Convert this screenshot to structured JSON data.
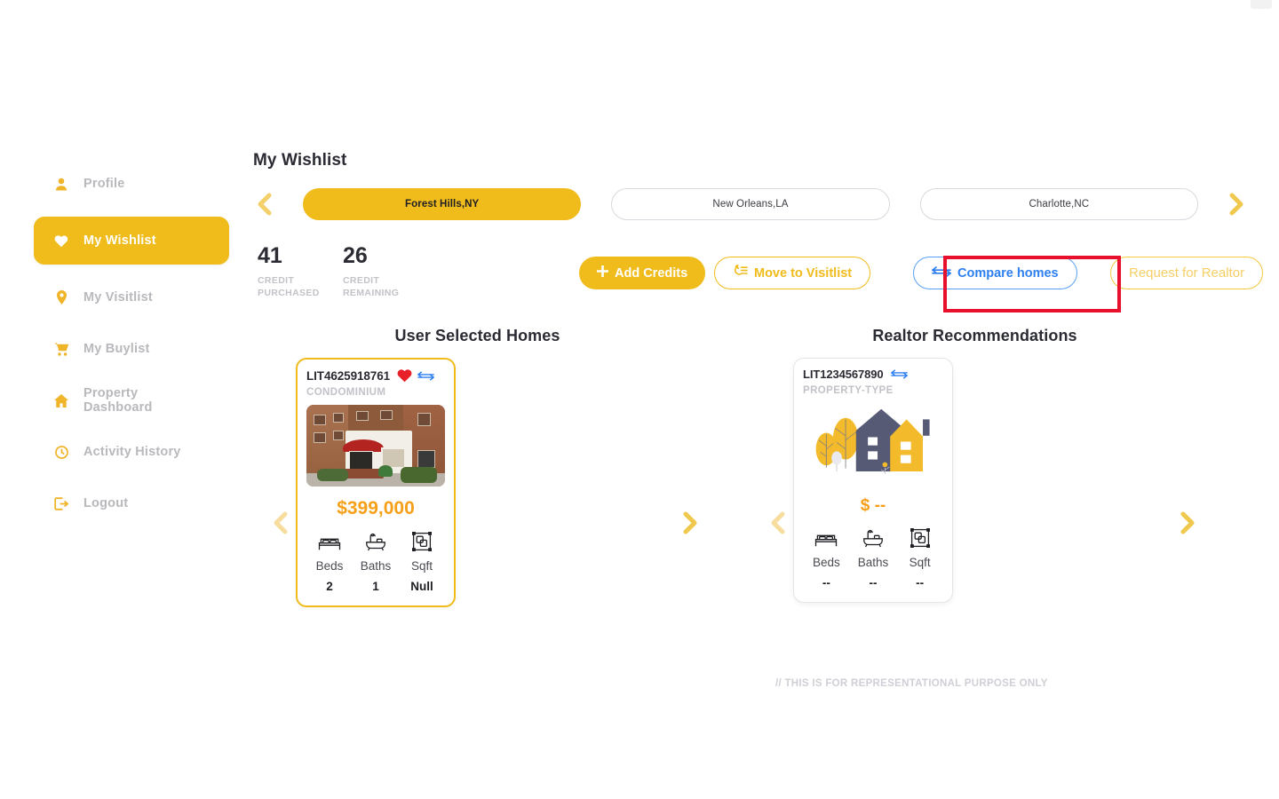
{
  "colors": {
    "brand_yellow": "#f0bc1c",
    "price_orange": "#f6a01a",
    "compare_blue": "#2d7ff0",
    "annotation_red": "#e8112d",
    "muted_gray": "#c2c2c8",
    "illustration_dark": "#575a75"
  },
  "sidebar": {
    "items": [
      {
        "label": "Profile",
        "icon": "user-icon",
        "active": false
      },
      {
        "label": "My Wishlist",
        "icon": "heart-icon",
        "active": true
      },
      {
        "label": "My Visitlist",
        "icon": "map-pin-icon",
        "active": false
      },
      {
        "label": "My Buylist",
        "icon": "cart-icon",
        "active": false
      },
      {
        "label": "Property Dashboard",
        "icon": "home-icon",
        "active": false
      },
      {
        "label": "Activity History",
        "icon": "clock-icon",
        "active": false
      },
      {
        "label": "Logout",
        "icon": "logout-icon",
        "active": false
      }
    ]
  },
  "header": {
    "title": "My Wishlist"
  },
  "city_tabs": {
    "prev_icon": "chevron-left-icon",
    "next_icon": "chevron-right-icon",
    "items": [
      {
        "label": "Forest Hills,NY",
        "active": true
      },
      {
        "label": "New Orleans,LA",
        "active": false
      },
      {
        "label": "Charlotte,NC",
        "active": false
      }
    ]
  },
  "credits": [
    {
      "value": "41",
      "label": "CREDIT PURCHASED"
    },
    {
      "value": "26",
      "label": "CREDIT REMAINING"
    }
  ],
  "toolbar": {
    "add_credits_label": "Add Credits",
    "add_credits_icon": "plus-icon",
    "move_to_visitlist_label": "Move to Visitlist",
    "move_to_visitlist_icon": "move-list-icon",
    "compare_homes_label": "Compare homes",
    "compare_homes_icon": "compare-arrows-icon",
    "request_realtor_label": "Request for Realtor"
  },
  "annotation": {
    "target": "Request for Realtor",
    "shape": "red-rectangle"
  },
  "sections": {
    "user_selected": {
      "heading": "User Selected Homes",
      "prev_icon": "chevron-left-icon",
      "next_icon": "chevron-right-icon",
      "card": {
        "id": "LIT4625918761",
        "favorite_icon": "heart-filled-icon",
        "compare_icon": "compare-arrows-icon",
        "property_type": "CONDOMINIUM",
        "image": "brick-apartment-building-photo",
        "price": "$399,000",
        "specs": [
          {
            "icon": "bed-icon",
            "label": "Beds",
            "value": "2"
          },
          {
            "icon": "bath-icon",
            "label": "Baths",
            "value": "1"
          },
          {
            "icon": "sqft-icon",
            "label": "Sqft",
            "value": "Null"
          }
        ]
      }
    },
    "realtor_recommendations": {
      "heading": "Realtor Recommendations",
      "prev_icon": "chevron-left-icon",
      "next_icon": "chevron-right-icon",
      "note": "// THIS IS FOR REPRESENTATIONAL PURPOSE ONLY",
      "card": {
        "id": "LIT1234567890",
        "compare_icon": "compare-arrows-icon",
        "property_type": "PROPERTY-TYPE",
        "image": "house-illustration-placeholder",
        "price": "$ --",
        "specs": [
          {
            "icon": "bed-icon",
            "label": "Beds",
            "value": "--"
          },
          {
            "icon": "bath-icon",
            "label": "Baths",
            "value": "--"
          },
          {
            "icon": "sqft-icon",
            "label": "Sqft",
            "value": "--"
          }
        ]
      }
    }
  }
}
